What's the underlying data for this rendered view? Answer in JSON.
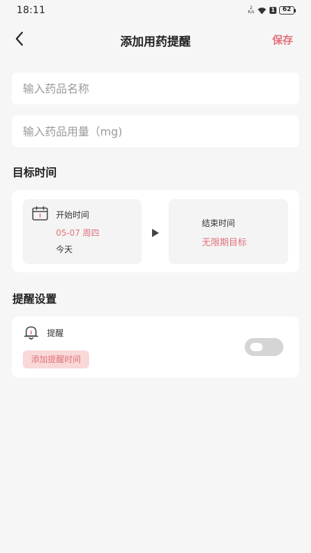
{
  "status_bar": {
    "time": "18:11",
    "net_speed_top": "2",
    "net_speed_bottom": "K/s",
    "sim": "1",
    "battery": "62"
  },
  "nav": {
    "back_icon": "chevron-left-icon",
    "title": "添加用药提醒",
    "save_label": "保存"
  },
  "form": {
    "name_placeholder": "输入药品名称",
    "dose_placeholder": "输入药品用量（mg)",
    "name_value": "",
    "dose_value": ""
  },
  "target_time": {
    "section_title": "目标时间",
    "start_label": "开始时间",
    "start_date": "05-07 周四",
    "start_day": "今天",
    "end_label": "结束时间",
    "end_value": "无限期目标"
  },
  "reminder": {
    "section_title": "提醒设置",
    "label": "提醒",
    "add_time_label": "添加提醒时间",
    "enabled": false
  },
  "colors": {
    "accent": "#e0727a",
    "accent_light": "#f9d8d8",
    "background": "#f6f6f6",
    "card": "#ffffff"
  }
}
